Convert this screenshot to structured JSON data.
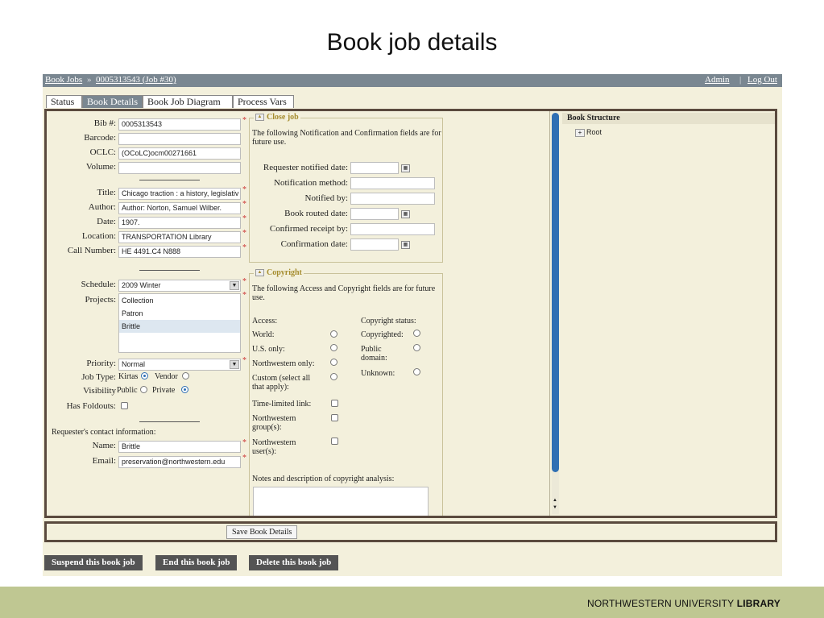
{
  "slide": {
    "title": "Book job details"
  },
  "breadcrumb": {
    "root": "Book Jobs",
    "separator": "»",
    "current": "0005313543 (Job #30)"
  },
  "topnav": {
    "admin": "Admin",
    "separator": "|",
    "logout": "Log Out"
  },
  "tabs": [
    "Status",
    "Book Details",
    "Book Job Diagram",
    "Process Vars"
  ],
  "active_tab": "Book Details",
  "details": {
    "bib_label": "Bib #:",
    "bib": "0005313543",
    "barcode_label": "Barcode:",
    "barcode": "",
    "oclc_label": "OCLC:",
    "oclc": "(OCoLC)ocm00271661",
    "volume_label": "Volume:",
    "volume": "",
    "title_label": "Title:",
    "title": "Chicago traction : a history, legislativ",
    "author_label": "Author:",
    "author": "Author: Norton, Samuel Wilber.",
    "date_label": "Date:",
    "date": "1907.",
    "location_label": "Location:",
    "location": "TRANSPORTATION Library",
    "callnumber_label": "Call Number:",
    "callnumber": "HE 4491.C4 N888",
    "schedule_label": "Schedule:",
    "schedule": "2009 Winter",
    "projects_label": "Projects:",
    "projects": [
      "Collection",
      "Patron",
      "Brittle"
    ],
    "projects_selected": "Brittle",
    "priority_label": "Priority:",
    "priority": "Normal",
    "jobtype_label": "Job Type:",
    "jobtype_kirtas": "Kirtas",
    "jobtype_vendor": "Vendor",
    "jobtype_selected": "Kirtas",
    "visibility_label": "Visibility",
    "visibility_public": "Public",
    "visibility_private": "Private",
    "visibility_selected": "Private",
    "foldouts_label": "Has Foldouts:",
    "requester_heading": "Requester's contact information:",
    "name_label": "Name:",
    "name": "Brittle",
    "email_label": "Email:",
    "email": "preservation@northwestern.edu",
    "required_mark": "*"
  },
  "close_job": {
    "legend": "Close job",
    "note": "The following Notification and Confirmation fields are for future use.",
    "requester_notified_label": "Requester notified date:",
    "notification_method_label": "Notification method:",
    "notified_by_label": "Notified by:",
    "book_routed_label": "Book routed date:",
    "confirmed_receipt_label": "Confirmed receipt by:",
    "confirmation_date_label": "Confirmation date:"
  },
  "copyright": {
    "legend": "Copyright",
    "note": "The following Access and Copyright fields are for future use.",
    "access_label": "Access:",
    "access_options": [
      "World:",
      "U.S. only:",
      "Northwestern only:",
      "Custom (select all that apply):"
    ],
    "custom_options": [
      "Time-limited link:",
      "Northwestern group(s):",
      "Northwestern user(s):"
    ],
    "status_label": "Copyright status:",
    "status_options": [
      "Copyrighted:",
      "Public domain:",
      "Unknown:"
    ],
    "notes_label": "Notes and description of copyright analysis:"
  },
  "structure": {
    "heading": "Book Structure",
    "root": "Root",
    "expander": "+"
  },
  "buttons": {
    "save": "Save Book Details",
    "suspend": "Suspend this book job",
    "end": "End this book job",
    "delete": "Delete this book job"
  },
  "footer": {
    "org": "NORTHWESTERN UNIVERSITY",
    "unit": "LIBRARY"
  },
  "colors": {
    "accent": "#2f6fb3",
    "topbar": "#7a8791",
    "frame": "#5a4a3e",
    "footer": "#bfc792",
    "legend": "#a58c2e"
  }
}
